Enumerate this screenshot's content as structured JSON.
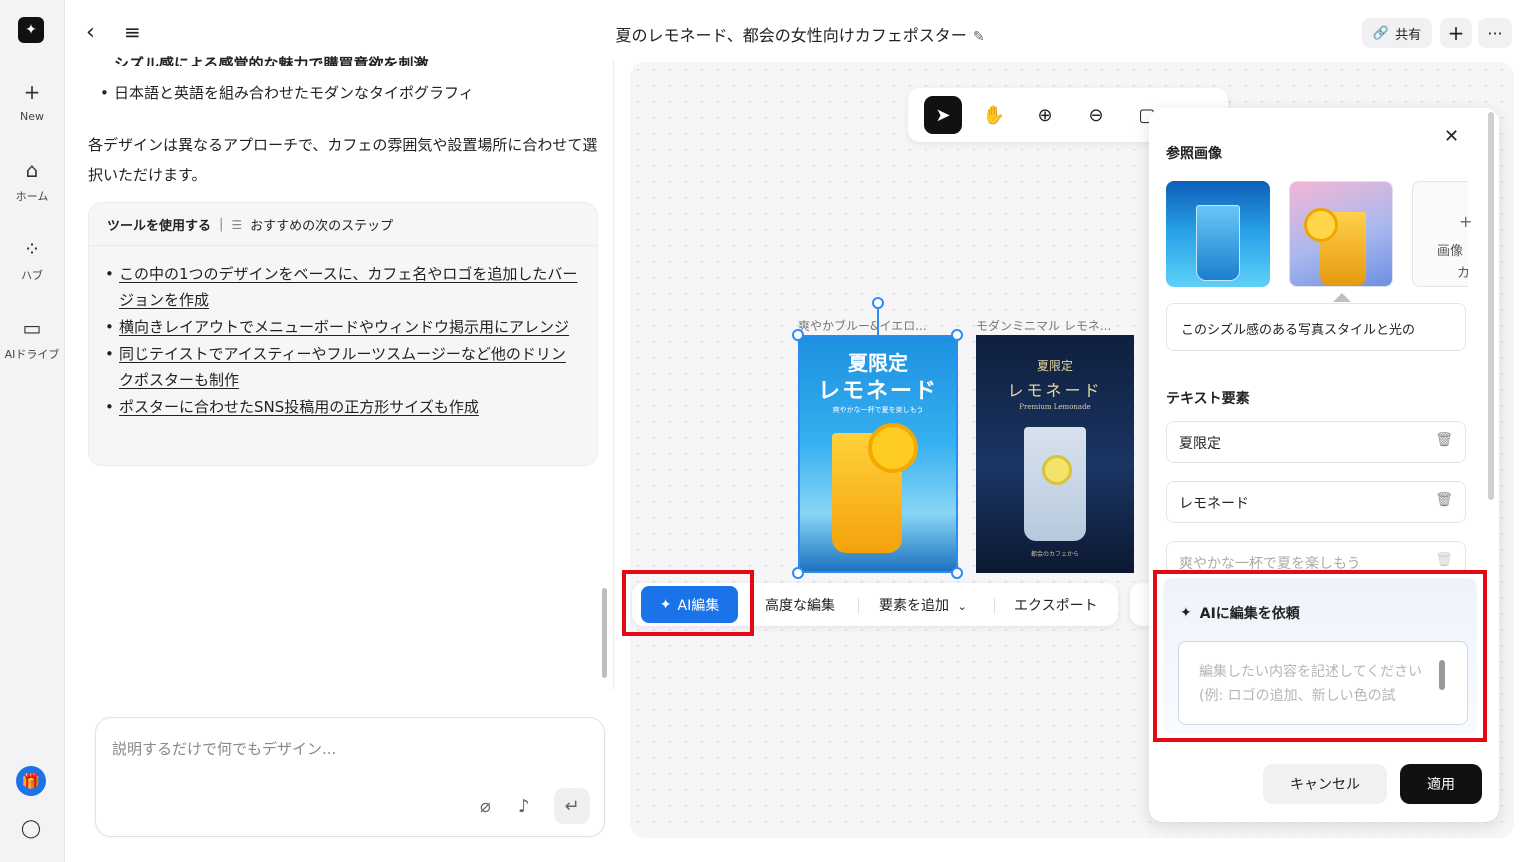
{
  "rail": {
    "items": [
      {
        "icon": "plus-icon",
        "glyph": "+",
        "label": "New"
      },
      {
        "icon": "home-icon",
        "glyph": "⌂",
        "label": "ホーム"
      },
      {
        "icon": "hub-icon",
        "glyph": "⁘",
        "label": "ハブ"
      },
      {
        "icon": "folder-icon",
        "glyph": "▭",
        "label": "AIドライブ"
      }
    ]
  },
  "header": {
    "title": "夏のレモネード、都会の女性向けカフェポスター",
    "share_label": "共有"
  },
  "chat": {
    "partial_bullet": "シズル感による感覚的な魅力で購買意欲を刺激",
    "bullet": "日本語と英語を組み合わせたモダンなタイポグラフィ",
    "paragraph": "各デザインは異なるアプローチで、カフェの雰囲気や設置場所に合わせて選択いただけます。",
    "tool_card": {
      "heading": "ツールを使用する",
      "separator": "|",
      "subheading": "おすすめの次のステップ",
      "items": [
        "この中の1つのデザインをベースに、カフェ名やロゴを追加したバージョンを作成",
        "横向きレイアウトでメニューボードやウィンドウ掲示用にアレンジ",
        "同じテイストでアイスティーやフルーツスムージーなど他のドリンクポスターも制作",
        "ポスターに合わせたSNS投稿用の正方形サイズも作成"
      ]
    },
    "input_placeholder": "説明するだけで何でもデザイン..."
  },
  "canvas": {
    "posters": [
      {
        "label": "爽やかブルー&イエロ...",
        "title1": "夏限定",
        "title2": "レモネード",
        "tagline": "爽やかな一杯で夏を楽しもう"
      },
      {
        "label": "モダンミニマル レモネ...",
        "title1": "夏限定",
        "title2": "レモネード",
        "subtitle": "Premium Lemonade",
        "footer": "都会のカフェから"
      }
    ],
    "actions": {
      "ai_edit": "AI編集",
      "advanced_edit": "高度な編集",
      "add_element": "要素を追加",
      "export": "エクスポート"
    }
  },
  "panel": {
    "ref_heading": "参照画像",
    "add_image_label_1": "画像",
    "add_image_label_2": "カ",
    "ref_description": "このシズル感のある写真スタイルと光の",
    "text_heading": "テキスト要素",
    "text_elements": [
      "夏限定",
      "レモネード",
      "爽やかな一杯で夏を楽しもう"
    ],
    "ai_request_heading": "AIに編集を依頼",
    "ai_request_placeholder": "編集したい内容を記述してください (例: ロゴの追加、新しい色の試",
    "cancel_label": "キャンセル",
    "apply_label": "適用"
  },
  "colors": {
    "accent": "#1a73e8",
    "highlight": "#e50914",
    "primary_dark": "#111111"
  }
}
